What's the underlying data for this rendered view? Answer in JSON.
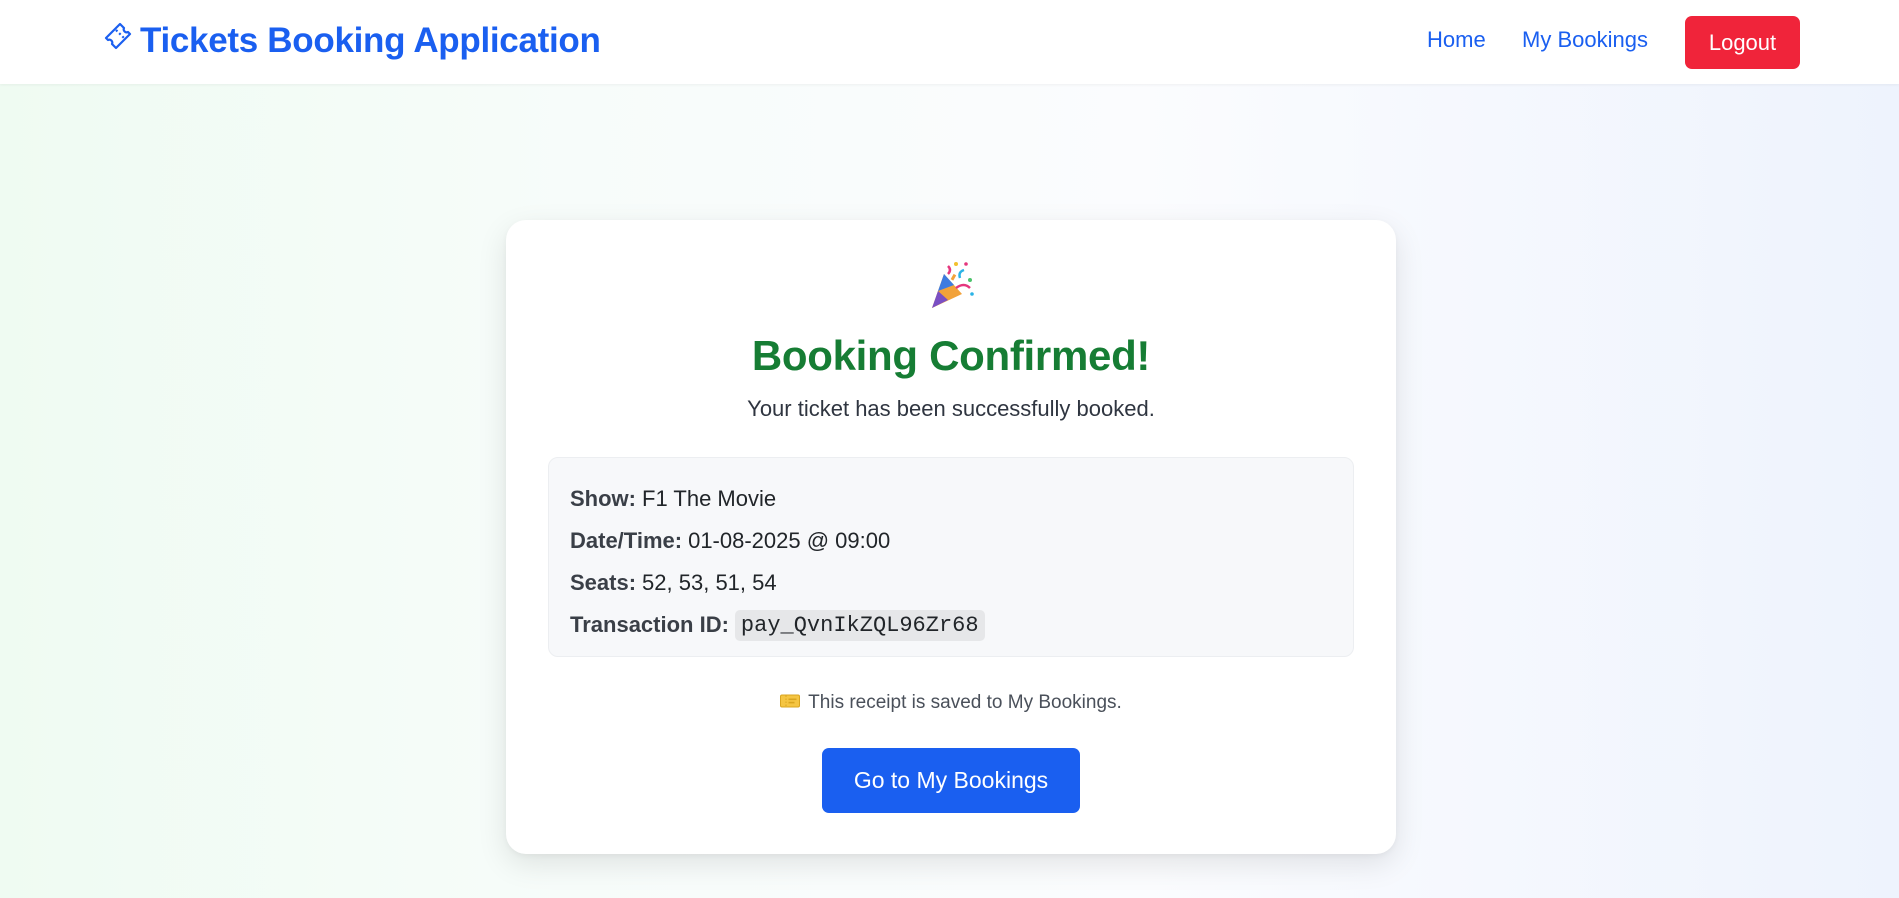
{
  "navbar": {
    "brand": "Tickets Booking Application",
    "brand_icon": "ticket-icon",
    "links": {
      "home": "Home",
      "my_bookings": "My Bookings"
    },
    "logout_label": "Logout"
  },
  "confirmation": {
    "icon": "party-popper-icon",
    "title": "Booking Confirmed!",
    "subtitle": "Your ticket has been successfully booked.",
    "details": {
      "show_label": "Show:",
      "show_value": "F1 The Movie",
      "datetime_label": "Date/Time:",
      "datetime_value": "01-08-2025 @ 09:00",
      "seats_label": "Seats:",
      "seats_value": "52, 53, 51, 54",
      "transaction_label": "Transaction ID:",
      "transaction_value": "pay_QvnIkZQL96Zr68"
    },
    "note_icon": "ticket-emoji-icon",
    "note": "This receipt is saved to My Bookings.",
    "button_label": "Go to My Bookings"
  },
  "colors": {
    "primary": "#1a5ff0",
    "danger": "#f0243a",
    "success": "#167d34"
  }
}
